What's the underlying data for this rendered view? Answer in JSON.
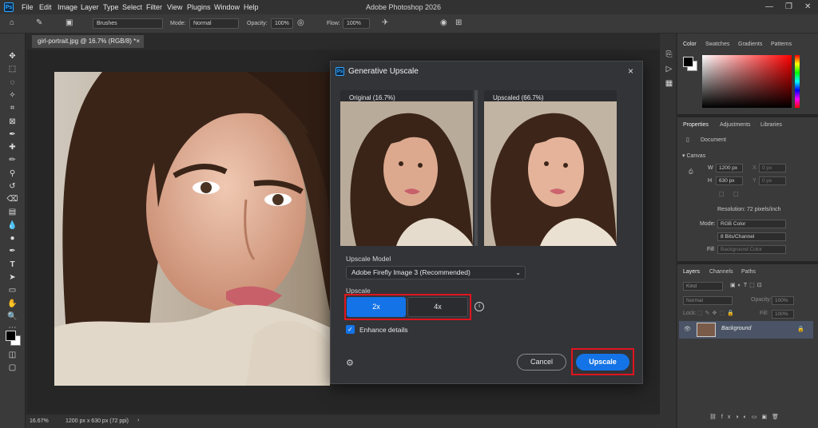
{
  "app": {
    "title": "Adobe Photoshop 2026",
    "menu": [
      "File",
      "Edit",
      "Image",
      "Layer",
      "Type",
      "Select",
      "Filter",
      "View",
      "Plugins",
      "Window",
      "Help"
    ],
    "logo": "Ps"
  },
  "options_bar": {
    "brush_preset": "Brushes",
    "mode_label": "Mode:",
    "mode_value": "Normal",
    "opacity_label": "Opacity:",
    "opacity_value": "100%",
    "flow_label": "Flow:",
    "flow_value": "100%"
  },
  "document": {
    "tab_label": "girl-portrait.jpg @ 16.7% (RGB/8) *",
    "close": "×"
  },
  "status_bar": {
    "zoom": "16.67%",
    "info": "1200 px x 630 px (72 ppi)"
  },
  "color_panel": {
    "tabs": [
      "Color",
      "Swatches",
      "Gradients",
      "Patterns"
    ]
  },
  "properties_panel": {
    "tabs": [
      "Properties",
      "Adjustments",
      "Libraries"
    ],
    "doc_label": "Document",
    "canvas_label": "Canvas",
    "w_label": "W",
    "w_value": "1200 px",
    "h_label": "H",
    "h_value": "630 px",
    "x_label": "X",
    "x_value": "0 px",
    "y_label": "Y",
    "y_value": "0 px",
    "resolution": "Resolution: 72 pixels/inch",
    "mode_label": "Mode:",
    "mode_value": "RGB Color",
    "bits_value": "8 Bits/Channel",
    "fill_label": "Fill",
    "fill_value": "Background Color"
  },
  "layers_panel": {
    "tabs": [
      "Layers",
      "Channels",
      "Paths"
    ],
    "filter_label": "Kind",
    "blend_mode": "Normal",
    "opacity_label": "Opacity:",
    "opacity_value": "100%",
    "lock_label": "Lock:",
    "fill_label": "Fill:",
    "fill_value": "100%",
    "layer_name": "Background"
  },
  "dialog": {
    "logo": "Ps",
    "title": "Generative Upscale",
    "close": "×",
    "original_label": "Original (16.7%)",
    "upscaled_label": "Upscaled (66.7%)",
    "model_label": "Upscale Model",
    "model_value": "Adobe Firefly Image 3 (Recommended)",
    "upscale_label": "Upscale",
    "option_2x": "2x",
    "option_4x": "4x",
    "selected_option": "2x",
    "enhance_label": "Enhance details",
    "enhance_checked": true,
    "cancel_label": "Cancel",
    "upscale_button": "Upscale"
  },
  "colors": {
    "accent": "#1473e6",
    "highlight": "#e0141e"
  }
}
